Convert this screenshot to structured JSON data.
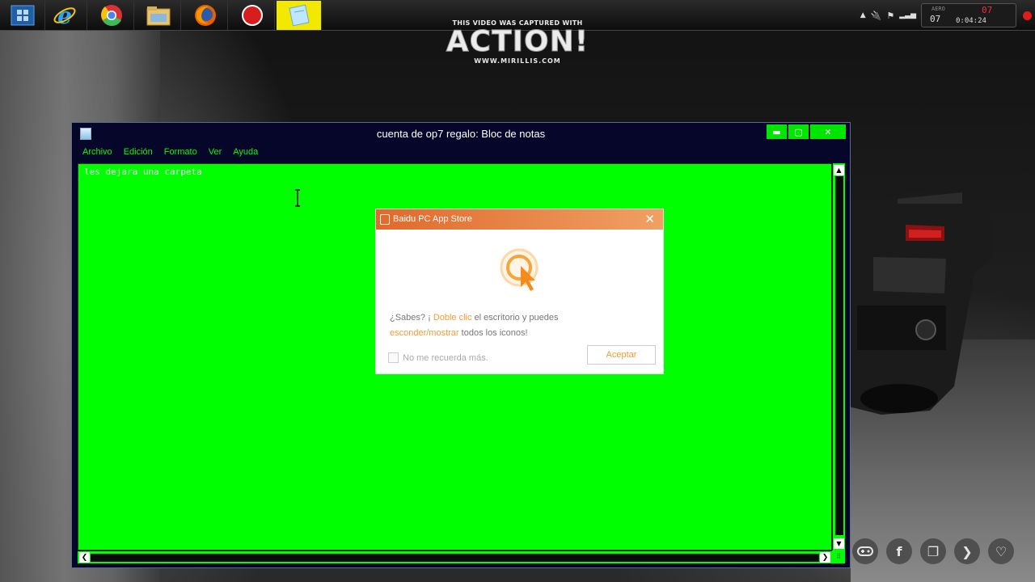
{
  "watermark": {
    "caption": "THIS VIDEO WAS CAPTURED WITH",
    "brand": "ACTION!",
    "url": "WWW.MIRILLIS.COM"
  },
  "taskbar": {
    "apps": [
      {
        "icon": "start-icon"
      },
      {
        "icon": "internet-explorer-icon"
      },
      {
        "icon": "chrome-icon"
      },
      {
        "icon": "file-explorer-icon"
      },
      {
        "icon": "firefox-icon"
      },
      {
        "icon": "record-icon"
      },
      {
        "icon": "notepad-icon",
        "active": true
      }
    ],
    "tray": {
      "aero_label": "AERO",
      "fps_left": "07",
      "fps_right": "07",
      "rec_time": "0:04:24"
    }
  },
  "notepad": {
    "title": "cuenta de op7 regalo: Bloc de notas",
    "menu": [
      "Archivo",
      "Edición",
      "Formato",
      "Ver",
      "Ayuda"
    ],
    "content": "les dejara una carpeta",
    "controls": {
      "minimize": "▬",
      "maximize": "▢",
      "close": "✕"
    }
  },
  "popup": {
    "title": "Baidu PC App Store",
    "msg_part1": "¿Sabes? ¡",
    "msg_highlight1": "Doble clic",
    "msg_part2": " el escritorio y puedes",
    "msg_highlight2": "esconder/mostrar",
    "msg_part3": " todos los iconos!",
    "checkbox_label": "No me recuerda más.",
    "accept_label": "Aceptar"
  },
  "share_icons": [
    {
      "name": "gamepad-icon",
      "glyph": "🎮"
    },
    {
      "name": "facebook-icon",
      "glyph": "f"
    },
    {
      "name": "copy-icon",
      "glyph": "❐"
    },
    {
      "name": "next-icon",
      "glyph": "❯"
    },
    {
      "name": "heart-icon",
      "glyph": "♡"
    }
  ],
  "colors": {
    "editor_bg": "#00ff00",
    "accent_orange": "#f29b38",
    "taskbar_active": "#f2e800"
  }
}
